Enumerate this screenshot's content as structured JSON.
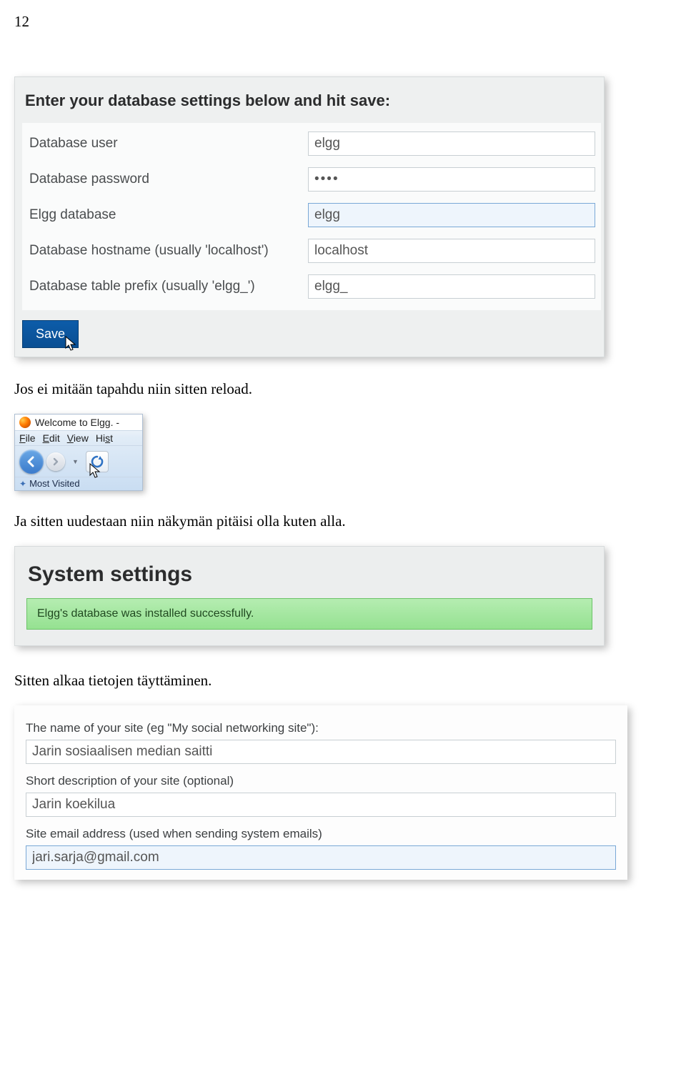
{
  "page_number": "12",
  "dbform": {
    "title": "Enter your database settings below and hit save:",
    "rows": {
      "user": {
        "label": "Database user",
        "value": "elgg"
      },
      "password": {
        "label": "Database password",
        "value": "••••"
      },
      "db": {
        "label": "Elgg database",
        "value": "elgg"
      },
      "host": {
        "label": "Database hostname (usually 'localhost')",
        "value": "localhost"
      },
      "prefix": {
        "label": "Database table prefix (usually 'elgg_')",
        "value": "elgg_"
      }
    },
    "save": "Save"
  },
  "text1": "Jos ei mitään tapahdu niin sitten reload.",
  "ff": {
    "tab_title": "Welcome to Elgg. -",
    "menu": {
      "file": "File",
      "edit": "Edit",
      "view": "View",
      "hist": "Hist"
    },
    "most_visited": "Most Visited"
  },
  "text2": "Ja sitten uudestaan niin näkymän pitäisi olla kuten alla.",
  "sys": {
    "title": "System settings",
    "msg": "Elgg's database was installed successfully."
  },
  "text3": "Sitten alkaa tietojen täyttäminen.",
  "siteform": {
    "name": {
      "label": "The name of your site (eg \"My social networking site\"):",
      "value": "Jarin sosiaalisen median saitti"
    },
    "desc": {
      "label": "Short description of your site (optional)",
      "value": "Jarin koekilua"
    },
    "email": {
      "label": "Site email address (used when sending system emails)",
      "value": "jari.sarja@gmail.com"
    }
  }
}
